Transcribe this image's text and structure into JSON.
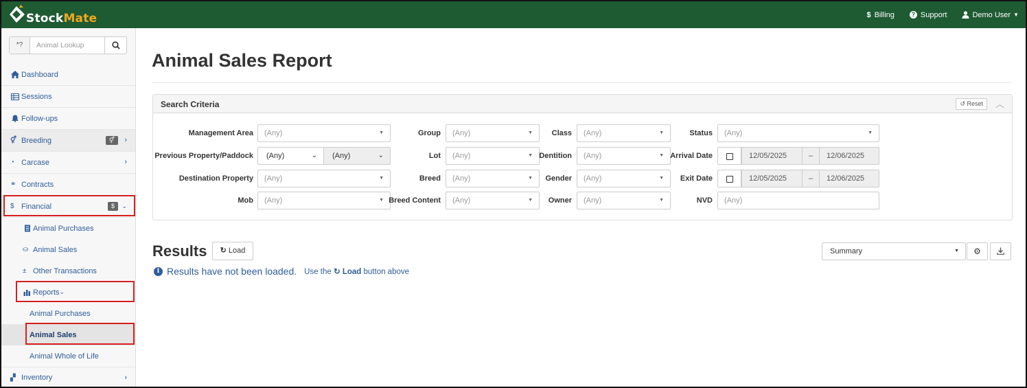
{
  "app": {
    "brand_stock": "Stock",
    "brand_mate": "Mate",
    "colors": {
      "topbar": "#1e5a32",
      "accent": "#f0a91e",
      "link": "#2f5d9a",
      "highlight": "#d61f1f"
    }
  },
  "topnav": {
    "billing": "Billing",
    "billing_icon": "$",
    "support": "Support",
    "support_icon": "?",
    "user": "Demo User"
  },
  "lookup": {
    "prefix": "*?",
    "placeholder": "Animal Lookup"
  },
  "sidebar": {
    "dashboard": "Dashboard",
    "sessions": "Sessions",
    "followups": "Follow-ups",
    "breeding": "Breeding",
    "carcase": "Carcase",
    "contracts": "Contracts",
    "financial": "Financial",
    "financial_badge": "$",
    "animal_purchases": "Animal Purchases",
    "animal_sales": "Animal Sales",
    "other_transactions": "Other Transactions",
    "reports": "Reports",
    "rep_animal_purchases": "Animal Purchases",
    "rep_animal_sales": "Animal Sales",
    "rep_whole_of_life": "Animal Whole of Life",
    "inventory": "Inventory"
  },
  "page": {
    "title": "Animal Sales Report"
  },
  "search": {
    "title": "Search Criteria",
    "reset": "Reset",
    "any": "(Any)",
    "labels": {
      "management_area": "Management Area",
      "previous_property": "Previous Property/Paddock",
      "destination_property": "Destination Property",
      "mob": "Mob",
      "group": "Group",
      "lot": "Lot",
      "breed": "Breed",
      "breed_content": "Breed Content",
      "class": "Class",
      "dentition": "Dentition",
      "gender": "Gender",
      "owner": "Owner",
      "status": "Status",
      "arrival_date": "Arrival Date",
      "exit_date": "Exit Date",
      "nvd": "NVD"
    },
    "arrival_from": "12/05/2025",
    "arrival_to": "12/06/2025",
    "exit_from": "12/05/2025",
    "exit_to": "12/06/2025",
    "range_sep": "–",
    "nvd_placeholder": "(Any)"
  },
  "results": {
    "title": "Results",
    "load": "Load",
    "view": "Summary",
    "message": "Results have not been loaded.",
    "hint_pre": "Use the",
    "hint_btn": "Load",
    "hint_post": "button above"
  }
}
